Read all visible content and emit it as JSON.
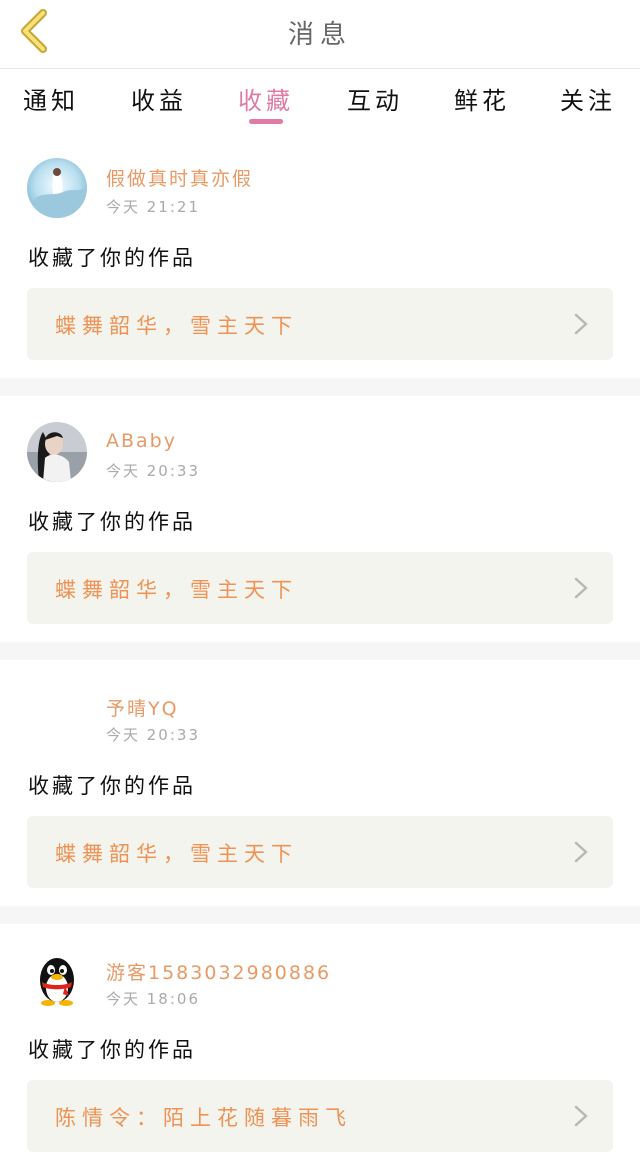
{
  "header": {
    "title": "消息",
    "back_icon": "chevron-left-icon"
  },
  "tabs": [
    {
      "label": "通知"
    },
    {
      "label": "收益"
    },
    {
      "label": "收藏",
      "active": true
    },
    {
      "label": "互动"
    },
    {
      "label": "鲜花"
    },
    {
      "label": "关注"
    }
  ],
  "messages": [
    {
      "user": "假做真时真亦假",
      "time": "今天 21:21",
      "action": "收藏了你的作品",
      "work": "蝶舞韶华，雪主天下",
      "avatar": "painting"
    },
    {
      "user": "ABaby",
      "time": "今天 20:33",
      "action": "收藏了你的作品",
      "work": "蝶舞韶华，雪主天下",
      "avatar": "photo"
    },
    {
      "user": "予晴YQ",
      "time": "今天 20:33",
      "action": "收藏了你的作品",
      "work": "蝶舞韶华，雪主天下",
      "avatar": "none"
    },
    {
      "user": "游客1583032980886",
      "time": "今天 18:06",
      "action": "收藏了你的作品",
      "work": "陈情令：陌上花随暮雨飞",
      "avatar": "penguin"
    }
  ],
  "colors": {
    "accent": "#e07aa6",
    "orange": "#ee9355",
    "name": "#e89a66"
  }
}
